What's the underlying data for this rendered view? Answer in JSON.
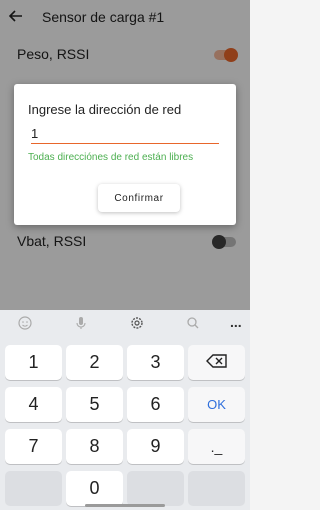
{
  "app": {
    "title": "Sensor de carga #1"
  },
  "rows": [
    {
      "label": "Peso, RSSI",
      "toggle": "on"
    },
    {
      "label": "Vbat, RSSI",
      "toggle": "off"
    }
  ],
  "dialog": {
    "title": "Ingrese la dirección de red",
    "input_value": "1",
    "message": "Todas direcciónes de red están libres",
    "confirm_label": "Confirmar"
  },
  "keyboard": {
    "toolbar_icons": [
      "emoji-icon",
      "mic-icon",
      "settings-icon",
      "search-icon",
      "more-icon"
    ],
    "more_label": "...",
    "keys": {
      "k1": "1",
      "k2": "2",
      "k3": "3",
      "k4": "4",
      "k5": "5",
      "k6": "6",
      "k7": "7",
      "k8": "8",
      "k9": "9",
      "k0": "0",
      "ok": "OK",
      "dot": "._"
    }
  },
  "colors": {
    "accent": "#e8662b",
    "success": "#4caf50",
    "ok_key": "#2f6fdc"
  }
}
